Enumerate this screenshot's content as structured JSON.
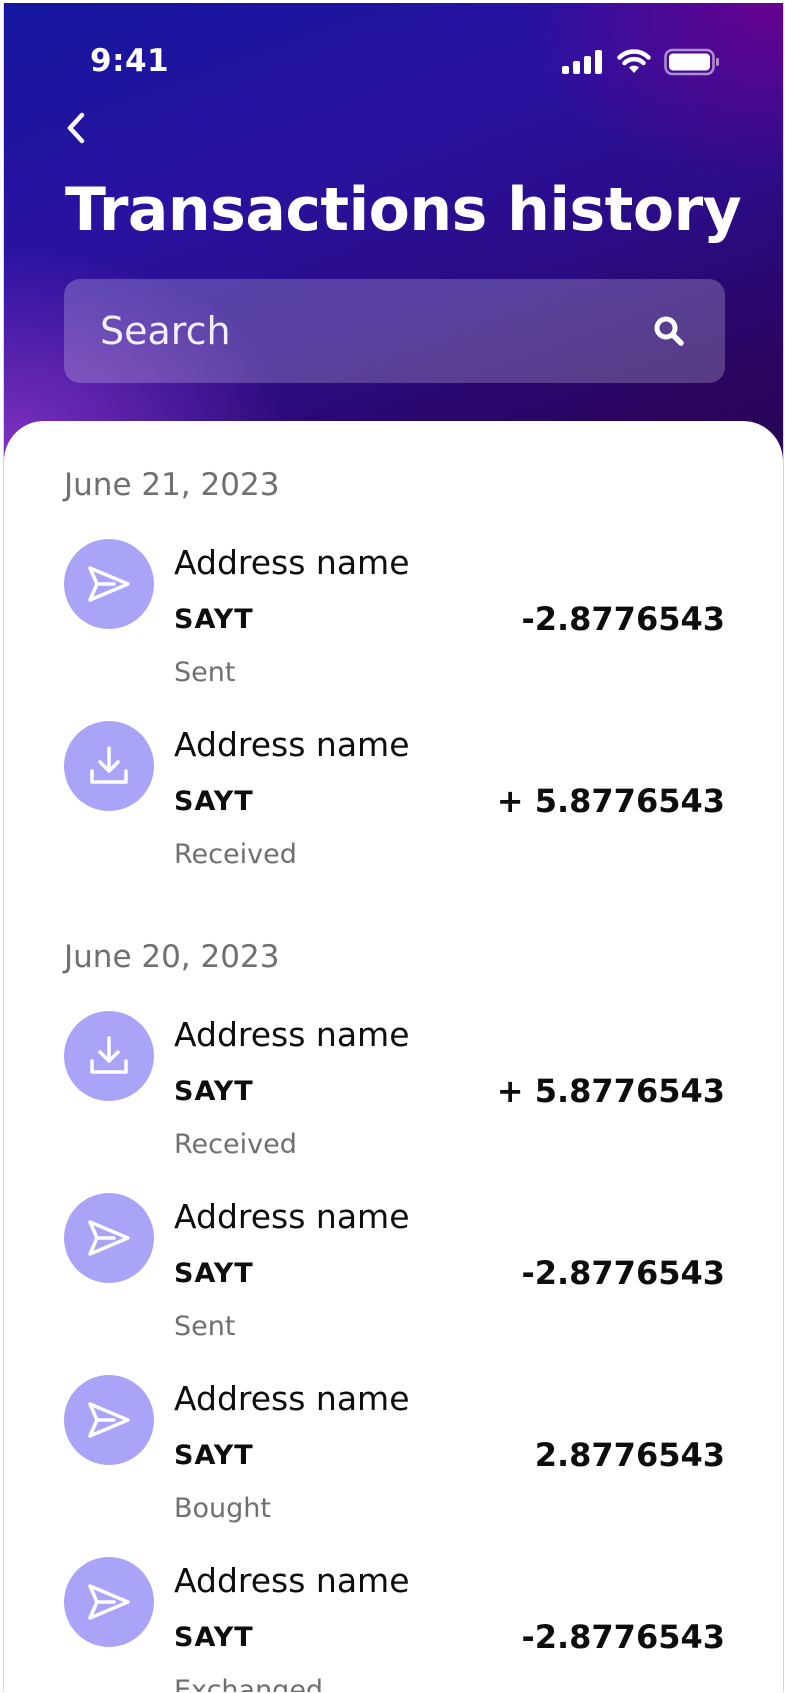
{
  "status_bar": {
    "time": "9:41"
  },
  "header": {
    "title": "Transactions history"
  },
  "search": {
    "placeholder": "Search"
  },
  "colors": {
    "accent": "#a9a4f7",
    "header_gradient": [
      "#15169e",
      "#2a12a0",
      "#2a0560"
    ],
    "text_primary": "#0d0d10",
    "text_secondary": "#6f6f74"
  },
  "groups": [
    {
      "date": "June 21, 2023",
      "transactions": [
        {
          "icon": "send-icon",
          "name": "Address name",
          "ticker": "SAYT",
          "type": "Sent",
          "amount": "-2.8776543"
        },
        {
          "icon": "download-icon",
          "name": "Address name",
          "ticker": "SAYT",
          "type": "Received",
          "amount": "+ 5.8776543"
        }
      ]
    },
    {
      "date": "June 20, 2023",
      "transactions": [
        {
          "icon": "download-icon",
          "name": "Address name",
          "ticker": "SAYT",
          "type": "Received",
          "amount": "+ 5.8776543"
        },
        {
          "icon": "send-icon",
          "name": "Address name",
          "ticker": "SAYT",
          "type": "Sent",
          "amount": "-2.8776543"
        },
        {
          "icon": "send-icon",
          "name": "Address name",
          "ticker": "SAYT",
          "type": "Bought",
          "amount": "2.8776543"
        },
        {
          "icon": "send-icon",
          "name": "Address name",
          "ticker": "SAYT",
          "type": "Exchanged",
          "amount": "-2.8776543"
        }
      ]
    }
  ]
}
